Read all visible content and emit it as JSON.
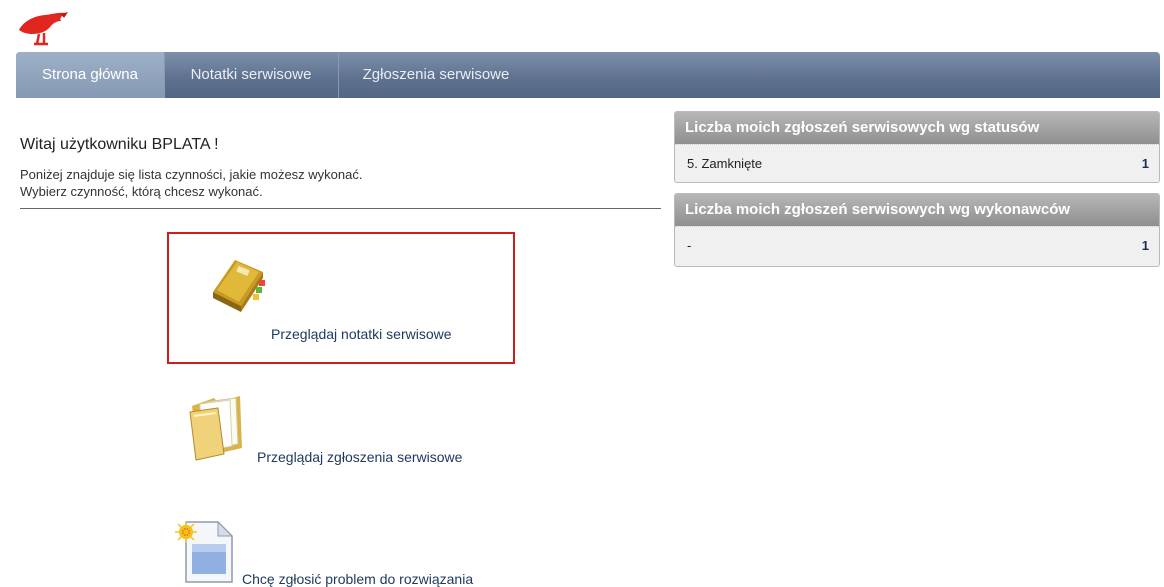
{
  "nav": {
    "tabs": [
      {
        "label": "Strona główna"
      },
      {
        "label": "Notatki serwisowe"
      },
      {
        "label": "Zgłoszenia serwisowe"
      }
    ]
  },
  "main": {
    "welcome": "Witaj użytkowniku BPLATA !",
    "intro_line1": "Poniżej znajduje się lista czynności, jakie możesz wykonać.",
    "intro_line2": "Wybierz czynność, którą chcesz wykonać.",
    "actions": [
      {
        "label": "Przeglądaj notatki serwisowe",
        "icon": "notebook-icon"
      },
      {
        "label": "Przeglądaj zgłoszenia serwisowe",
        "icon": "folder-icon"
      },
      {
        "label": "Chcę zgłosić problem do rozwiązania",
        "icon": "new-document-icon"
      }
    ]
  },
  "panels": [
    {
      "title": "Liczba moich zgłoszeń serwisowych wg statusów",
      "rows": [
        {
          "label": "5. Zamknięte",
          "count": "1"
        }
      ]
    },
    {
      "title": "Liczba moich zgłoszeń serwisowych wg wykonawców",
      "rows": [
        {
          "label": "-",
          "count": "1"
        }
      ]
    }
  ],
  "colors": {
    "nav_bg": "#5f7290",
    "nav_active": "#8fa3bd",
    "selection_border": "#d01c1c",
    "panel_header": "#a3a3a3",
    "logo": "#e0261e"
  }
}
